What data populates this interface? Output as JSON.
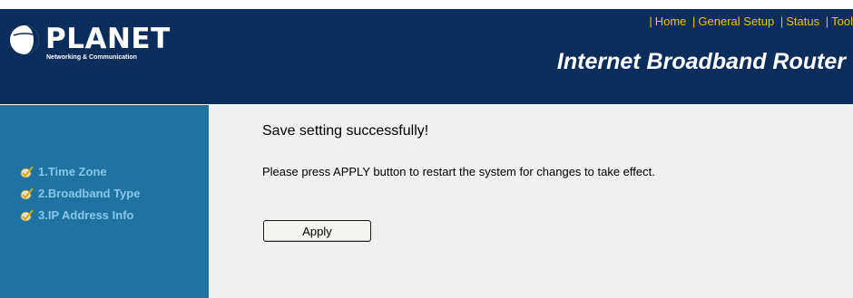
{
  "header": {
    "logo_text": "PLANET",
    "logo_tagline": "Networking & Communication",
    "product_title": "Internet Broadband Router",
    "nav": [
      {
        "label": "Home"
      },
      {
        "label": "General Setup"
      },
      {
        "label": "Status"
      },
      {
        "label": "Tool"
      }
    ]
  },
  "sidebar": {
    "items": [
      {
        "label": "1.Time Zone",
        "icon": "checkmark-icon"
      },
      {
        "label": "2.Broadband Type",
        "icon": "checkmark-icon"
      },
      {
        "label": "3.IP Address Info",
        "icon": "checkmark-icon"
      }
    ]
  },
  "main": {
    "title": "Save setting successfully!",
    "message": "Please press APPLY button to restart the system for changes to take effect.",
    "apply_label": "Apply"
  },
  "colors": {
    "header_bg": "#0b2d5c",
    "sidebar_bg": "#1f72a2",
    "sidebar_text": "#87c6ee",
    "nav_link": "#f5c200",
    "content_bg": "#f0f0f0"
  }
}
